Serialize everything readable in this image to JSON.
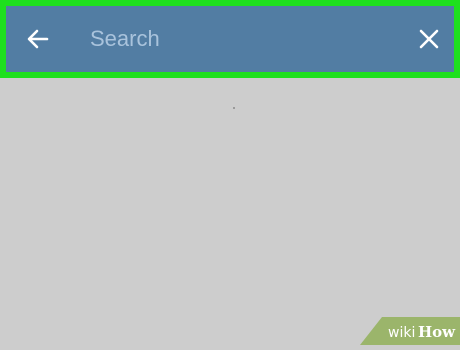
{
  "colors": {
    "highlight": "#1ee01e",
    "toolbar": "#527da3",
    "background": "#cdcdcd",
    "icon": "#ffffff",
    "placeholder": "#a9c3dc"
  },
  "toolbar": {
    "back_icon": "arrow-left-icon",
    "search": {
      "placeholder": "Search",
      "value": ""
    },
    "close_icon": "close-icon"
  },
  "watermark": {
    "text_wiki": "wiki",
    "text_how": "How"
  }
}
